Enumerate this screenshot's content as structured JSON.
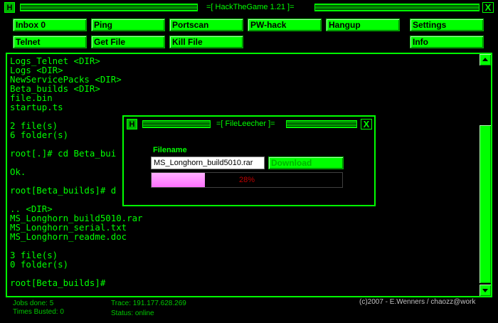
{
  "window": {
    "title": "=[ HackTheGame 1.21 ]=",
    "sys_icon": "H",
    "close_glyph": "X"
  },
  "toolbar": {
    "row1": [
      "Inbox 0",
      "Ping",
      "Portscan",
      "PW-hack",
      "Hangup",
      "Settings"
    ],
    "row2": [
      "Telnet",
      "Get File",
      "Kill File",
      "Info"
    ]
  },
  "terminal": {
    "lines": [
      "Logs_Telnet <DIR>",
      "Logs <DIR>",
      "NewServicePacks <DIR>",
      "Beta_builds <DIR>",
      "file.bin",
      "startup.ts",
      "",
      "2 file(s)",
      "6 folder(s)",
      "",
      "root[.]# cd Beta_bui",
      "",
      "Ok.",
      "",
      "root[Beta_builds]# d",
      "",
      ".. <DIR>",
      "MS_Longhorn_build5010.rar",
      "MS_Longhorn_serial.txt",
      "MS_Longhorn_readme.doc",
      "",
      "3 file(s)",
      "0 folder(s)",
      "",
      "root[Beta_builds]#"
    ]
  },
  "status": {
    "jobs_done": "Jobs done: 5",
    "times_busted": "Times Busted: 0",
    "trace": "Trace: 191.177.628.269",
    "status": "Status: online",
    "copyright": "(c)2007 - E.Wenners / chaozz@work"
  },
  "dialog": {
    "title": "=[ FileLeecher ]=",
    "sys_icon": "H",
    "close_glyph": "X",
    "filename_label": "Filename",
    "filename_value": "MS_Longhorn_build5010.rar",
    "download_label": "Download",
    "progress_percent": 28,
    "progress_text": "28%"
  },
  "colors": {
    "accent": "#00ff00",
    "background": "#000000",
    "progress": "#ff80ff"
  }
}
